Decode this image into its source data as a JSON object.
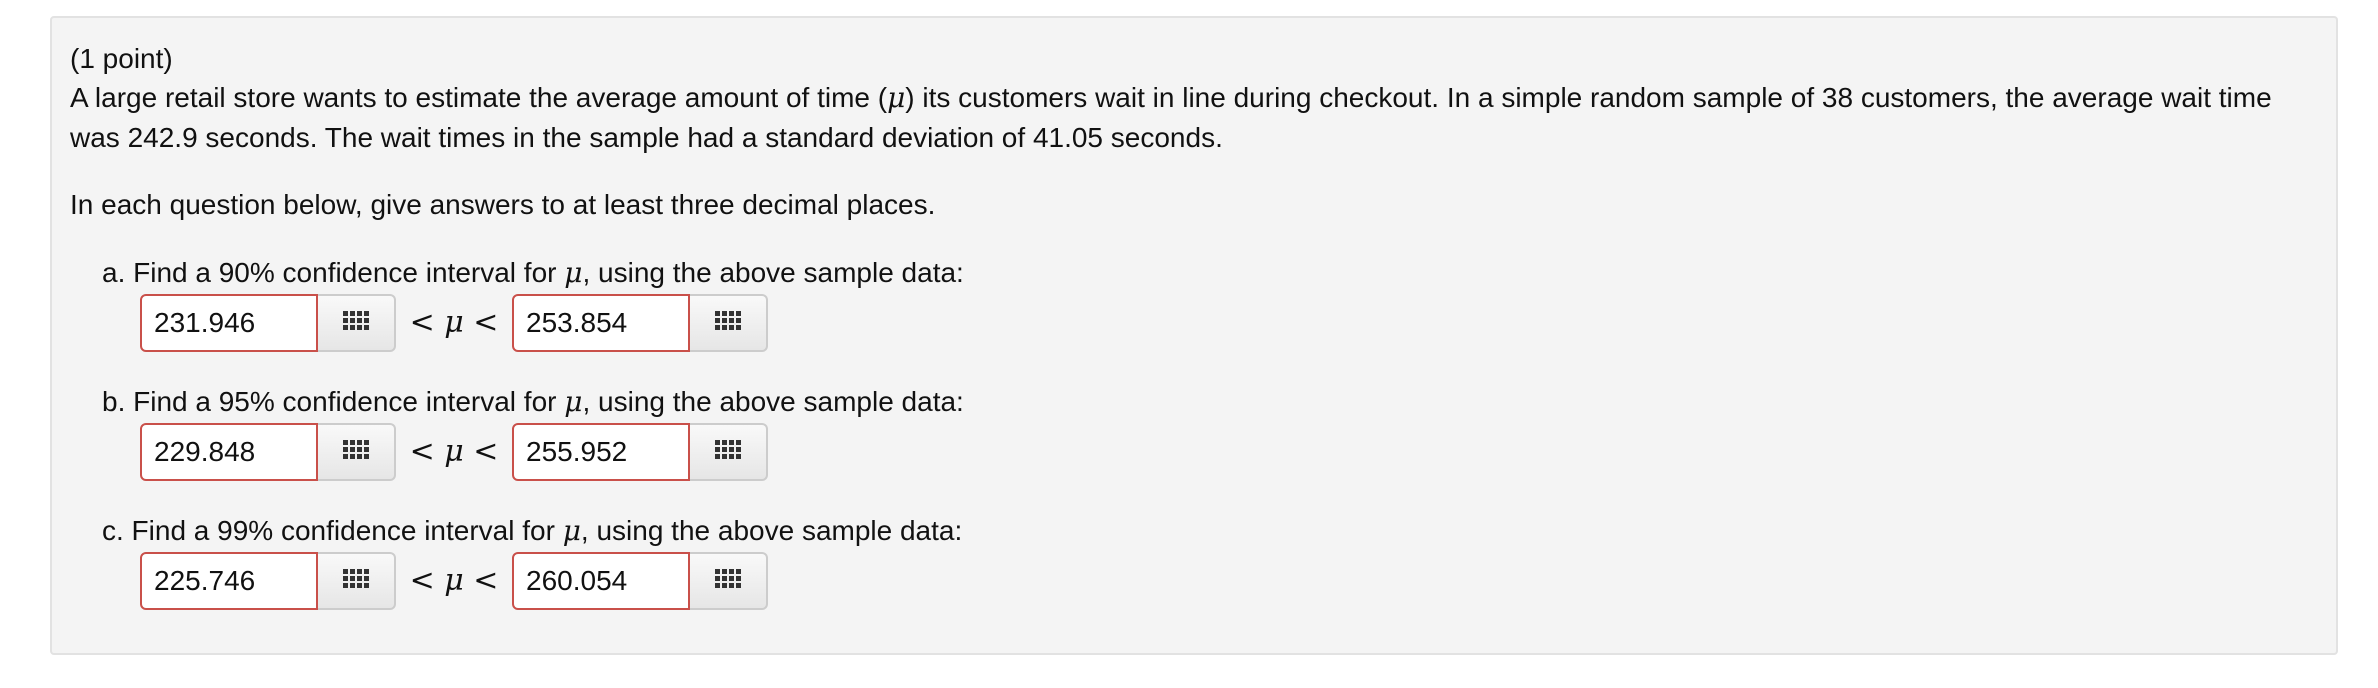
{
  "problem": {
    "points": "(1 point)",
    "statement_before_mu": "A large retail store wants to estimate the average amount of time (",
    "mu_symbol": "μ",
    "statement_after_mu": ") its customers wait in line during checkout. In a simple random sample of 38 customers, the average wait time was 242.9 seconds. The wait times in the sample had a standard deviation of 41.05 seconds.",
    "instructions": "In each question below, give answers to at least three decimal places."
  },
  "questions": [
    {
      "prefix": "a. Find a 90% confidence interval for ",
      "suffix": ", using the above sample data:",
      "lower_value": "231.946",
      "upper_value": "253.854"
    },
    {
      "prefix": "b. Find a 95% confidence interval for ",
      "suffix": ", using the above sample data:",
      "lower_value": "229.848",
      "upper_value": "255.952"
    },
    {
      "prefix": "c. Find a 99% confidence interval for ",
      "suffix": ", using the above sample data:",
      "lower_value": "225.746",
      "upper_value": "260.054"
    }
  ],
  "inequality": {
    "less_than": "<",
    "mu": "μ"
  },
  "icons": {
    "keypad": "keypad-grid-icon"
  },
  "colors": {
    "panel_background": "#f4f4f4",
    "input_border_error": "#c9504a",
    "keypad_icon": "#333333"
  }
}
